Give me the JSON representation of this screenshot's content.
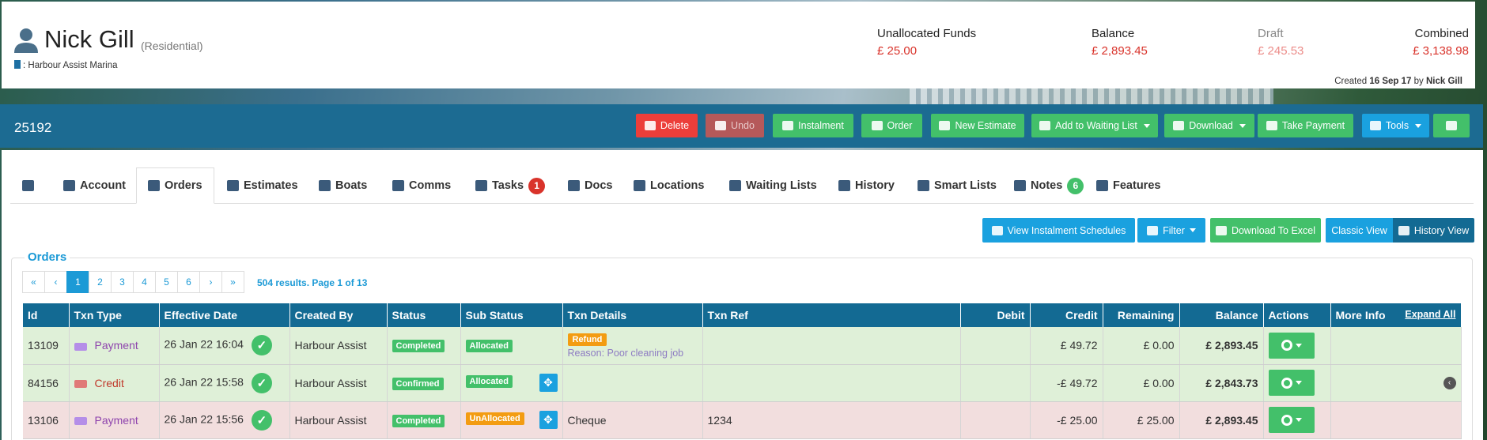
{
  "customer": {
    "name": "Nick Gill",
    "type": "(Residential)",
    "marina": ": Harbour Assist Marina"
  },
  "funds": [
    {
      "label": "Unallocated Funds",
      "value": "£ 25.00"
    },
    {
      "label": "Balance",
      "value": "£ 2,893.45"
    },
    {
      "label": "Draft",
      "value": "£ 245.53"
    },
    {
      "label": "Combined",
      "value": "£ 3,138.98"
    }
  ],
  "created": {
    "prefix": "Created",
    "date": "16 Sep 17",
    "by": "by",
    "user": "Nick Gill"
  },
  "record_id": "25192",
  "toolbar": {
    "delete": "Delete",
    "undo": "Undo",
    "instalment": "Instalment",
    "order": "Order",
    "new_estimate": "New Estimate",
    "waiting_list": "Add to Waiting List",
    "download": "Download",
    "take_payment": "Take Payment",
    "tools": "Tools"
  },
  "tabs": {
    "account": "Account",
    "orders": "Orders",
    "estimates": "Estimates",
    "boats": "Boats",
    "comms": "Comms",
    "tasks": "Tasks",
    "tasks_badge": "1",
    "docs": "Docs",
    "locations": "Locations",
    "waiting_lists": "Waiting Lists",
    "history": "History",
    "smart_lists": "Smart Lists",
    "notes": "Notes",
    "notes_badge": "6",
    "features": "Features"
  },
  "actions": {
    "instalments": "View Instalment Schedules",
    "filter": "Filter",
    "excel": "Download To Excel",
    "classic": "Classic View",
    "history": "History View"
  },
  "orders": {
    "title": "Orders",
    "pager": [
      "«",
      "‹",
      "1",
      "2",
      "3",
      "4",
      "5",
      "6",
      "›",
      "»"
    ],
    "results": "504 results. Page 1 of 13",
    "columns": {
      "id": "Id",
      "type": "Txn Type",
      "date": "Effective Date",
      "by": "Created By",
      "status": "Status",
      "sub": "Sub Status",
      "details": "Txn Details",
      "ref": "Txn Ref",
      "debit": "Debit",
      "credit": "Credit",
      "remaining": "Remaining",
      "balance": "Balance",
      "actions": "Actions",
      "more": "More Info",
      "expand": "Expand All"
    },
    "rows": [
      {
        "id": "13109",
        "type": "Payment",
        "date": "26 Jan 22 16:04",
        "by": "Harbour Assist",
        "status": "Completed",
        "sub": "Allocated",
        "refund": "Refund",
        "reason": "Reason: Poor cleaning job",
        "details": "",
        "ref": "",
        "debit": "",
        "credit": "£ 49.72",
        "remaining": "£ 0.00",
        "balance": "£ 2,893.45"
      },
      {
        "id": "84156",
        "type": "Credit",
        "date": "26 Jan 22 15:58",
        "by": "Harbour Assist",
        "status": "Confirmed",
        "sub": "Allocated",
        "details": "",
        "ref": "",
        "debit": "",
        "credit": "-£ 49.72",
        "remaining": "£ 0.00",
        "balance": "£ 2,843.73"
      },
      {
        "id": "13106",
        "type": "Payment",
        "date": "26 Jan 22 15:56",
        "by": "Harbour Assist",
        "status": "Completed",
        "sub": "UnAllocated",
        "details": "Cheque",
        "ref": "1234",
        "debit": "",
        "credit": "-£ 25.00",
        "remaining": "£ 25.00",
        "balance": "£ 2,893.45"
      }
    ]
  },
  "colors": {
    "nav": "#1c6b92",
    "header": "#136a93",
    "accent": "#1c9ad6",
    "green": "#43c06a",
    "red": "#ec3e3a"
  }
}
